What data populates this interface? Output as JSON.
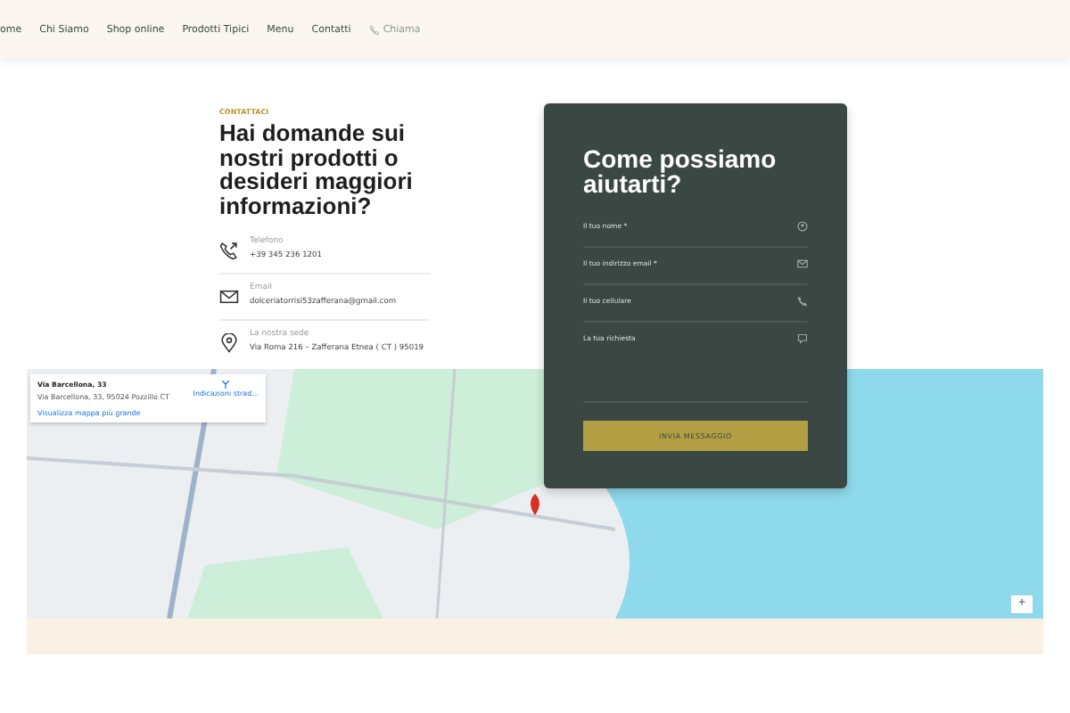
{
  "nav": {
    "items": [
      {
        "label": "ome"
      },
      {
        "label": "Chi Siamo"
      },
      {
        "label": "Shop online"
      },
      {
        "label": "Prodotti Tipici"
      },
      {
        "label": "Menu"
      },
      {
        "label": "Contatti"
      }
    ],
    "call": "Chiama"
  },
  "contact": {
    "eyebrow": "CONTATTACI",
    "heading": "Hai domande sui nostri prodotti o desideri maggiori informazioni?",
    "items": [
      {
        "kind": "phone",
        "label": "Telefono",
        "value": "+39 345 236 1201"
      },
      {
        "kind": "email",
        "label": "Email",
        "value": "dolceriatorrisi53zafferana@gmail.com"
      },
      {
        "kind": "location",
        "label": "La nostra sede",
        "value": "Via Roma 216 – Zafferana Etnea ( CT ) 95019"
      }
    ]
  },
  "form": {
    "title": "Come possiamo aiutarti?",
    "fields": [
      {
        "kind": "user",
        "placeholder": "Il tuo nome *"
      },
      {
        "kind": "email",
        "placeholder": "Il tuo indirizzo email *"
      },
      {
        "kind": "phone",
        "placeholder": "Il tuo cellulare"
      },
      {
        "kind": "message",
        "placeholder": "La tua richiesta"
      }
    ],
    "submit": "INVIA MESSAGGIO"
  },
  "map": {
    "place_title": "Via Barcellona, 33",
    "place_address": "Via Barcellona, 33, 95024 Pozzillo CT",
    "directions": "Indicazioni strad...",
    "larger_map": "Visualizza mappa più grande",
    "zoom_in": "+"
  }
}
